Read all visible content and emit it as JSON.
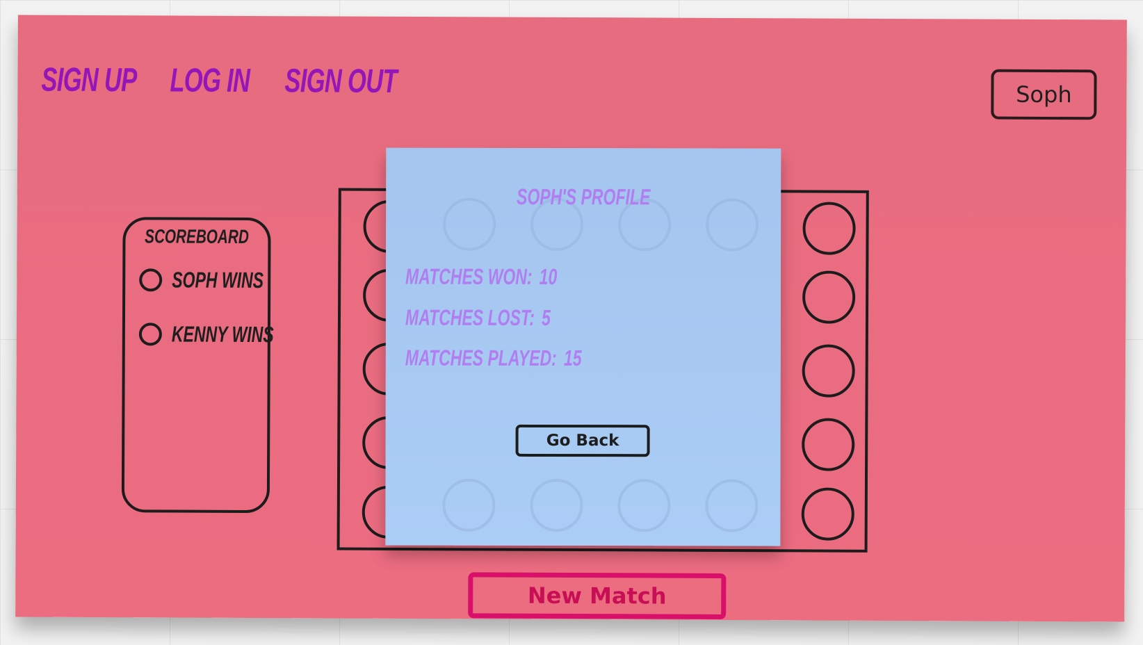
{
  "nav": {
    "sign_up": "Sign Up",
    "log_in": "Log In",
    "sign_out": "Sign Out"
  },
  "user": {
    "name": "Soph"
  },
  "scoreboard": {
    "title": "Scoreboard",
    "options": [
      {
        "label": "Soph Wins",
        "selected": false
      },
      {
        "label": "Kenny Wins",
        "selected": false
      }
    ]
  },
  "profile": {
    "title": "Soph's Profile",
    "stats": [
      {
        "label": "Matches Won:",
        "value": "10"
      },
      {
        "label": "Matches Lost:",
        "value": "5"
      },
      {
        "label": "Matches Played:",
        "value": "15"
      }
    ],
    "go_back_label": "Go Back"
  },
  "actions": {
    "new_match_label": "New Match"
  },
  "colors": {
    "background": "#ec6c80",
    "nav_text": "#9516b8",
    "modal_background": "#a8c9f2",
    "modal_text": "#b07ef0",
    "new_match_accent": "#d9106a"
  }
}
